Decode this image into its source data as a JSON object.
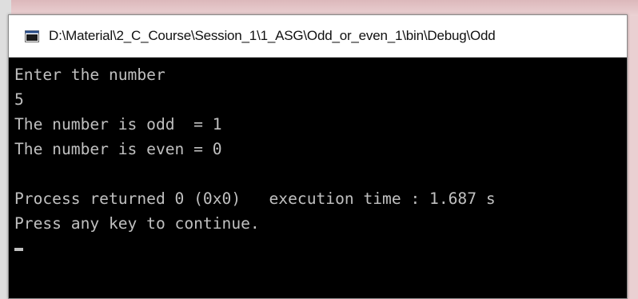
{
  "window": {
    "title": "D:\\Material\\2_C_Course\\Session_1\\1_ASG\\Odd_or_even_1\\bin\\Debug\\Odd",
    "icon": "console-window-icon"
  },
  "console": {
    "lines": [
      "Enter the number",
      "5",
      "The number is odd  = 1",
      "The number is even = 0",
      "",
      "Process returned 0 (0x0)   execution time : 1.687 s",
      "Press any key to continue."
    ],
    "cursor": "_"
  },
  "colors": {
    "console_bg": "#000000",
    "console_text": "#c0c0c0",
    "titlebar_bg": "#ffffff",
    "icon_accent": "#2b4f8c"
  }
}
